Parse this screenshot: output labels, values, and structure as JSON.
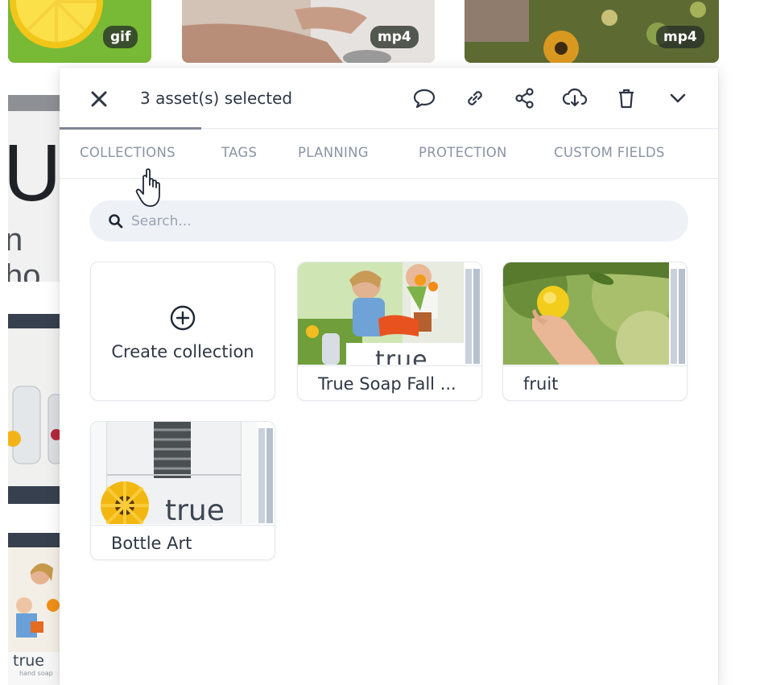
{
  "background": {
    "thumbnails": [
      {
        "badge": "gif"
      },
      {
        "badge": "mp4"
      },
      {
        "badge": "mp4"
      }
    ],
    "strip_texts": {
      "big_letter": "U",
      "partial_text": "n ho",
      "true_brand": "true",
      "true_sub": "hand soap"
    }
  },
  "panel": {
    "selected_text": "3 asset(s) selected",
    "toolbar": {
      "close": "close-icon",
      "comment": "comment-icon",
      "link": "link-icon",
      "share": "share-icon",
      "download": "download-cloud-icon",
      "delete": "trash-icon",
      "more": "chevron-down-icon"
    },
    "tabs": [
      {
        "label": "COLLECTIONS",
        "active": true
      },
      {
        "label": "TAGS",
        "active": false
      },
      {
        "label": "PLANNING",
        "active": false
      },
      {
        "label": "PROTECTION",
        "active": false
      },
      {
        "label": "CUSTOM FIELDS",
        "active": false
      }
    ],
    "search": {
      "placeholder": "Search..."
    },
    "create_label": "Create collection",
    "collections": [
      {
        "name": "True Soap Fall ...",
        "image_text": "true"
      },
      {
        "name": "fruit"
      },
      {
        "name": "Bottle Art",
        "image_text": "true"
      }
    ]
  },
  "colors": {
    "accent_text": "#2e3645",
    "tab_inactive": "#8a93a6",
    "search_bg": "#eef1f6",
    "badge_bg": "#283028"
  }
}
